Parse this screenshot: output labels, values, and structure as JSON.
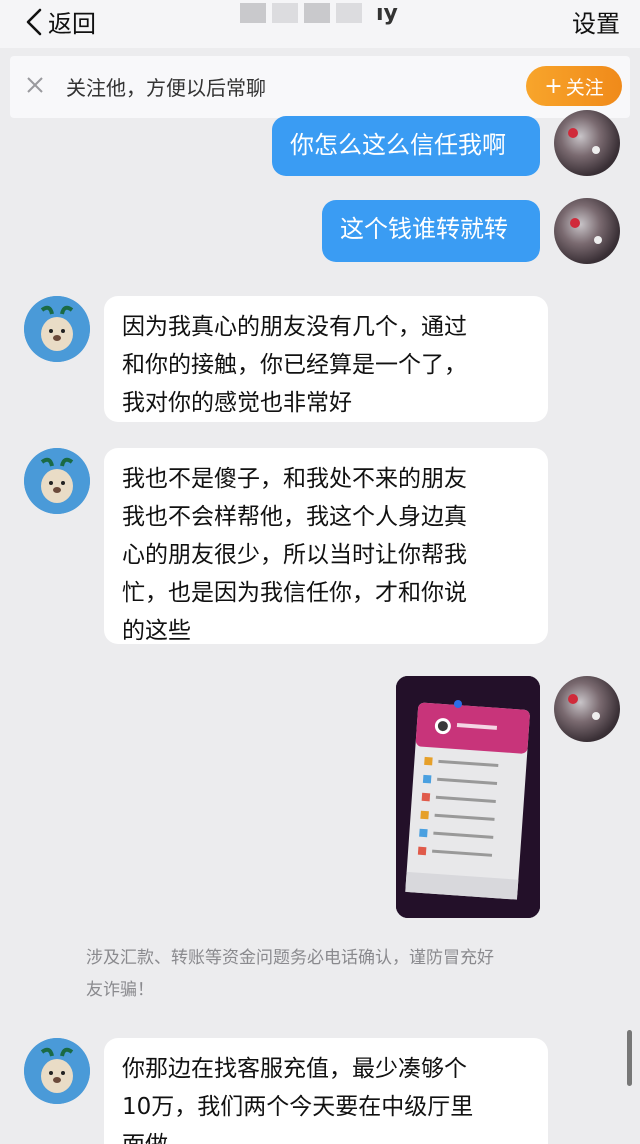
{
  "header": {
    "back_label": "返回",
    "title_visible_fragment": "ıy",
    "settings_label": "设置"
  },
  "follow_prompt": {
    "text": "关注他，方便以后常聊",
    "button_label": "关注",
    "button_plus": "+"
  },
  "messages": [
    {
      "side": "right",
      "text": "你怎么这么信任我啊"
    },
    {
      "side": "right",
      "text": "这个钱谁转就转"
    },
    {
      "side": "left",
      "lines": [
        "因为我真心的朋友没有几个，通过",
        "和你的接触，你已经算是一个了，",
        "我对你的感觉也非常好"
      ]
    },
    {
      "side": "left",
      "lines": [
        "我也不是傻子，和我处不来的朋友",
        "我也不会样帮他，我这个人身边真",
        "心的朋友很少，所以当时让你帮我",
        "忙，也是因为我信任你，才和你说",
        "的这些"
      ]
    },
    {
      "side": "right",
      "type": "image"
    },
    {
      "side": "left",
      "lines": [
        "你那边在找客服充值，最少凑够个",
        "10万，我们两个今天要在中级厅里",
        "面做"
      ]
    }
  ],
  "system_notice": {
    "lines": [
      "涉及汇款、转账等资金问题务必电话确认，谨防冒充好",
      "友诈骗！"
    ]
  },
  "colors": {
    "outgoing_bubble": "#3a9cf3",
    "incoming_bubble": "#ffffff",
    "follow_button": "#f39a22",
    "background": "#ececee"
  }
}
